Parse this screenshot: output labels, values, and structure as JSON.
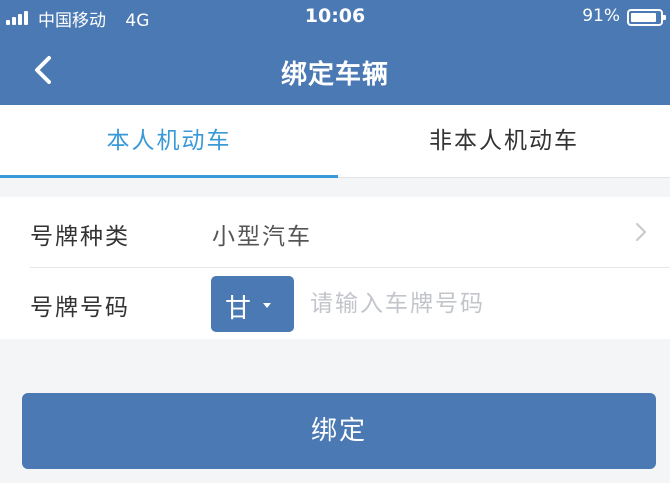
{
  "status_bar": {
    "carrier": "中国移动",
    "network": "4G",
    "time": "10:06",
    "battery": "91%",
    "battery_level": 0.91
  },
  "nav": {
    "back_icon": "chevron-left-icon",
    "title": "绑定车辆"
  },
  "tabs": [
    {
      "label": "本人机动车",
      "active": true
    },
    {
      "label": "非本人机动车",
      "active": false
    }
  ],
  "form": {
    "plate_type": {
      "label": "号牌种类",
      "value": "小型汽车",
      "icon": "chevron-right-icon"
    },
    "plate_number": {
      "label": "号牌号码",
      "province": "甘",
      "placeholder": "请输入车牌号码",
      "value": ""
    }
  },
  "bind_button": {
    "label": "绑定"
  },
  "colors": {
    "primary": "#4a79b3",
    "tab_active": "#3a9ad8",
    "background": "#f4f5f7"
  }
}
